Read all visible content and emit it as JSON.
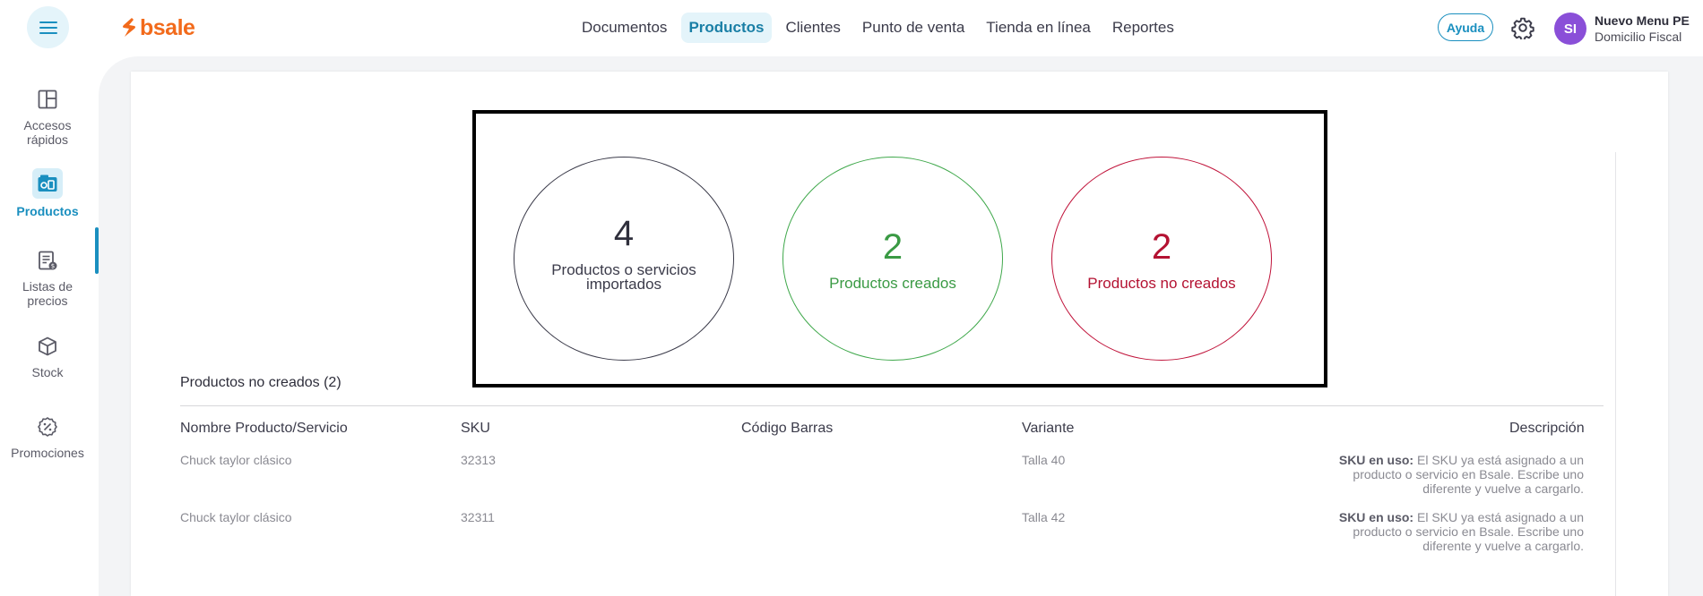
{
  "header": {
    "logo_text": "bsale",
    "nav": [
      {
        "label": "Documentos",
        "active": false
      },
      {
        "label": "Productos",
        "active": true
      },
      {
        "label": "Clientes",
        "active": false
      },
      {
        "label": "Punto de venta",
        "active": false
      },
      {
        "label": "Tienda en línea",
        "active": false
      },
      {
        "label": "Reportes",
        "active": false
      }
    ],
    "help_label": "Ayuda",
    "avatar_initials": "SI",
    "account_name": "Nuevo Menu PE",
    "account_sub": "Domicilio Fiscal"
  },
  "sidebar": {
    "items": [
      {
        "label_line1": "Accesos",
        "label_line2": "rápidos",
        "icon": "layout-icon"
      },
      {
        "label_line1": "Productos",
        "label_line2": "",
        "icon": "products-icon",
        "active": true
      },
      {
        "label_line1": "Listas de",
        "label_line2": "precios",
        "icon": "price-list-icon"
      },
      {
        "label_line1": "Stock",
        "label_line2": "",
        "icon": "box-icon"
      },
      {
        "label_line1": "Promociones",
        "label_line2": "",
        "icon": "discount-icon"
      }
    ]
  },
  "summary": {
    "imported": {
      "value": "4",
      "caption_line1": "Productos o servicios",
      "caption_line2": "importados"
    },
    "created": {
      "value": "2",
      "caption": "Productos creados"
    },
    "not_created": {
      "value": "2",
      "caption": "Productos no creados"
    }
  },
  "table": {
    "title": "Productos no creados (2)",
    "columns": [
      "Nombre Producto/Servicio",
      "SKU",
      "Código Barras",
      "Variante",
      "Descripción"
    ],
    "rows": [
      {
        "name": "Chuck taylor clásico",
        "sku": "32313",
        "barcode": "",
        "variant": "Talla 40",
        "desc_label": "SKU en uso:",
        "desc_line1": " El SKU ya está asignado a un",
        "desc_line2": "producto o servicio en Bsale. Escribe uno",
        "desc_line3": "diferente y vuelve a cargarlo."
      },
      {
        "name": "Chuck taylor clásico",
        "sku": "32311",
        "barcode": "",
        "variant": "Talla 42",
        "desc_label": "SKU en uso:",
        "desc_line1": " El SKU ya está asignado a un",
        "desc_line2": "producto o servicio en Bsale. Escribe uno",
        "desc_line3": "diferente y vuelve a cargarlo."
      }
    ]
  },
  "colors": {
    "accent": "#1a8fbf",
    "brand": "#f26a1b",
    "success": "#3a9a44",
    "error": "#b41232",
    "avatar": "#8a4fd8"
  }
}
